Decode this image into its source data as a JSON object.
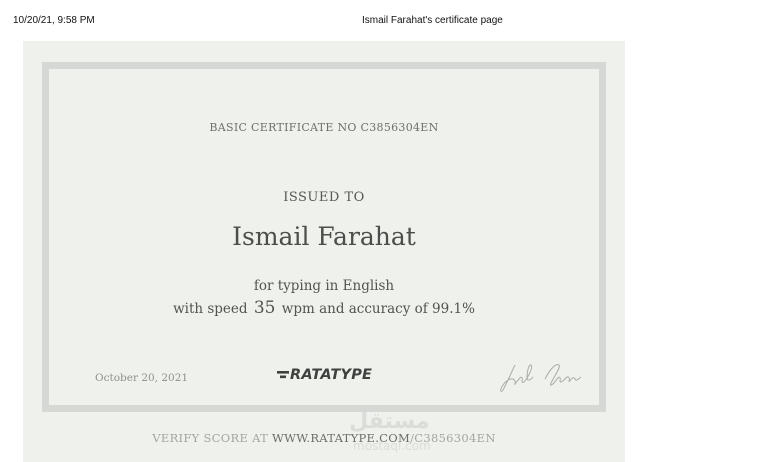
{
  "print_header": {
    "datetime": "10/20/21, 9:58 PM",
    "page_title": "Ismail Farahat's certificate page"
  },
  "certificate": {
    "number_line": "BASIC CERTIFICATE NO C3856304EN",
    "issued_to_label": "ISSUED TO",
    "recipient_name": "Ismail Farahat",
    "typing_language_line": "for typing in English",
    "speed_prefix": "with speed",
    "speed_value": "35",
    "speed_suffix": "wpm and accuracy of 99.1%",
    "date": "October 20, 2021",
    "logo_text": "RATATYPE",
    "verify_prefix": "VERIFY SCORE AT",
    "verify_site": "WWW.RATATYPE.COM",
    "verify_code": "/C3856304EN"
  },
  "watermark": {
    "arabic": "مستقل",
    "latin": "mostaql.com"
  },
  "colors": {
    "sheet_background": "#eef1ec",
    "frame_border": "#d5d8d4",
    "text_primary": "#4b4e4b",
    "text_muted": "#a3a6a3"
  }
}
